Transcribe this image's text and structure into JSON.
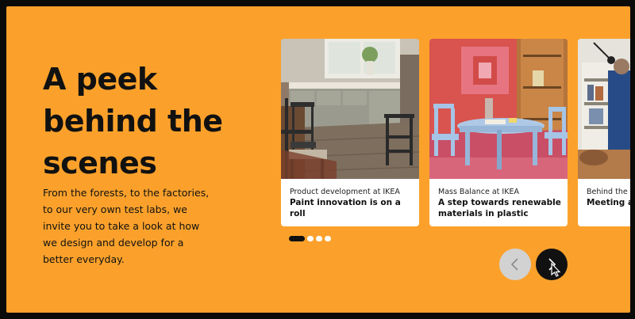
{
  "section": {
    "headline_line1": "A peek",
    "headline_line2": "behind the",
    "headline_line3": "scenes",
    "intro": "From the forests, to the factories, to our very own test labs, we invite you to take a look at how we design and develop for a better everyday."
  },
  "carousel": {
    "cards": [
      {
        "kicker": "Product development at IKEA",
        "title": "Paint innovation is on a roll",
        "image": "kitchen-dining-room-photo"
      },
      {
        "kicker": "Mass Balance at IKEA",
        "title": "A step towards renewable materials in plastic",
        "image": "childrens-table-chairs-photo"
      },
      {
        "kicker": "Behind the sc",
        "title": "Meeting an",
        "image": "workspace-photo"
      }
    ],
    "pagination": {
      "count": 4,
      "active_index": 0
    },
    "prev_icon": "chevron-left-icon",
    "next_icon": "chevron-right-icon"
  },
  "colors": {
    "background": "#fba12b",
    "text": "#111111",
    "card": "#ffffff",
    "next_button": "#111111",
    "prev_button": "#d2d2d2"
  }
}
